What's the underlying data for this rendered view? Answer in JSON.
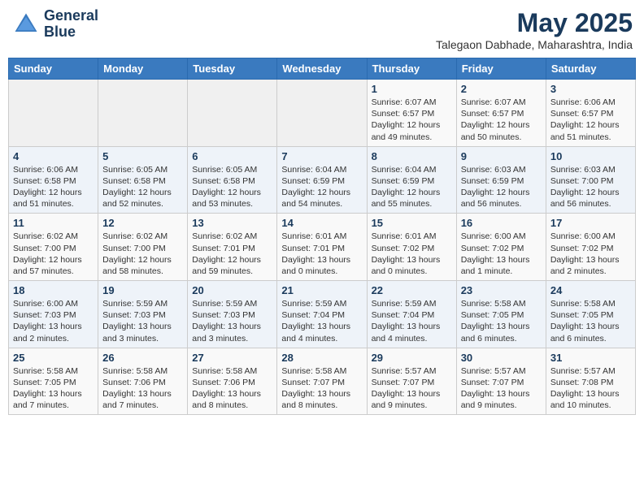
{
  "header": {
    "logo_line1": "General",
    "logo_line2": "Blue",
    "month_year": "May 2025",
    "location": "Talegaon Dabhade, Maharashtra, India"
  },
  "weekdays": [
    "Sunday",
    "Monday",
    "Tuesday",
    "Wednesday",
    "Thursday",
    "Friday",
    "Saturday"
  ],
  "weeks": [
    [
      {
        "day": "",
        "info": ""
      },
      {
        "day": "",
        "info": ""
      },
      {
        "day": "",
        "info": ""
      },
      {
        "day": "",
        "info": ""
      },
      {
        "day": "1",
        "info": "Sunrise: 6:07 AM\nSunset: 6:57 PM\nDaylight: 12 hours\nand 49 minutes."
      },
      {
        "day": "2",
        "info": "Sunrise: 6:07 AM\nSunset: 6:57 PM\nDaylight: 12 hours\nand 50 minutes."
      },
      {
        "day": "3",
        "info": "Sunrise: 6:06 AM\nSunset: 6:57 PM\nDaylight: 12 hours\nand 51 minutes."
      }
    ],
    [
      {
        "day": "4",
        "info": "Sunrise: 6:06 AM\nSunset: 6:58 PM\nDaylight: 12 hours\nand 51 minutes."
      },
      {
        "day": "5",
        "info": "Sunrise: 6:05 AM\nSunset: 6:58 PM\nDaylight: 12 hours\nand 52 minutes."
      },
      {
        "day": "6",
        "info": "Sunrise: 6:05 AM\nSunset: 6:58 PM\nDaylight: 12 hours\nand 53 minutes."
      },
      {
        "day": "7",
        "info": "Sunrise: 6:04 AM\nSunset: 6:59 PM\nDaylight: 12 hours\nand 54 minutes."
      },
      {
        "day": "8",
        "info": "Sunrise: 6:04 AM\nSunset: 6:59 PM\nDaylight: 12 hours\nand 55 minutes."
      },
      {
        "day": "9",
        "info": "Sunrise: 6:03 AM\nSunset: 6:59 PM\nDaylight: 12 hours\nand 56 minutes."
      },
      {
        "day": "10",
        "info": "Sunrise: 6:03 AM\nSunset: 7:00 PM\nDaylight: 12 hours\nand 56 minutes."
      }
    ],
    [
      {
        "day": "11",
        "info": "Sunrise: 6:02 AM\nSunset: 7:00 PM\nDaylight: 12 hours\nand 57 minutes."
      },
      {
        "day": "12",
        "info": "Sunrise: 6:02 AM\nSunset: 7:00 PM\nDaylight: 12 hours\nand 58 minutes."
      },
      {
        "day": "13",
        "info": "Sunrise: 6:02 AM\nSunset: 7:01 PM\nDaylight: 12 hours\nand 59 minutes."
      },
      {
        "day": "14",
        "info": "Sunrise: 6:01 AM\nSunset: 7:01 PM\nDaylight: 13 hours\nand 0 minutes."
      },
      {
        "day": "15",
        "info": "Sunrise: 6:01 AM\nSunset: 7:02 PM\nDaylight: 13 hours\nand 0 minutes."
      },
      {
        "day": "16",
        "info": "Sunrise: 6:00 AM\nSunset: 7:02 PM\nDaylight: 13 hours\nand 1 minute."
      },
      {
        "day": "17",
        "info": "Sunrise: 6:00 AM\nSunset: 7:02 PM\nDaylight: 13 hours\nand 2 minutes."
      }
    ],
    [
      {
        "day": "18",
        "info": "Sunrise: 6:00 AM\nSunset: 7:03 PM\nDaylight: 13 hours\nand 2 minutes."
      },
      {
        "day": "19",
        "info": "Sunrise: 5:59 AM\nSunset: 7:03 PM\nDaylight: 13 hours\nand 3 minutes."
      },
      {
        "day": "20",
        "info": "Sunrise: 5:59 AM\nSunset: 7:03 PM\nDaylight: 13 hours\nand 3 minutes."
      },
      {
        "day": "21",
        "info": "Sunrise: 5:59 AM\nSunset: 7:04 PM\nDaylight: 13 hours\nand 4 minutes."
      },
      {
        "day": "22",
        "info": "Sunrise: 5:59 AM\nSunset: 7:04 PM\nDaylight: 13 hours\nand 4 minutes."
      },
      {
        "day": "23",
        "info": "Sunrise: 5:58 AM\nSunset: 7:05 PM\nDaylight: 13 hours\nand 6 minutes."
      },
      {
        "day": "24",
        "info": "Sunrise: 5:58 AM\nSunset: 7:05 PM\nDaylight: 13 hours\nand 6 minutes."
      }
    ],
    [
      {
        "day": "25",
        "info": "Sunrise: 5:58 AM\nSunset: 7:05 PM\nDaylight: 13 hours\nand 7 minutes."
      },
      {
        "day": "26",
        "info": "Sunrise: 5:58 AM\nSunset: 7:06 PM\nDaylight: 13 hours\nand 7 minutes."
      },
      {
        "day": "27",
        "info": "Sunrise: 5:58 AM\nSunset: 7:06 PM\nDaylight: 13 hours\nand 8 minutes."
      },
      {
        "day": "28",
        "info": "Sunrise: 5:58 AM\nSunset: 7:07 PM\nDaylight: 13 hours\nand 8 minutes."
      },
      {
        "day": "29",
        "info": "Sunrise: 5:57 AM\nSunset: 7:07 PM\nDaylight: 13 hours\nand 9 minutes."
      },
      {
        "day": "30",
        "info": "Sunrise: 5:57 AM\nSunset: 7:07 PM\nDaylight: 13 hours\nand 9 minutes."
      },
      {
        "day": "31",
        "info": "Sunrise: 5:57 AM\nSunset: 7:08 PM\nDaylight: 13 hours\nand 10 minutes."
      }
    ]
  ]
}
